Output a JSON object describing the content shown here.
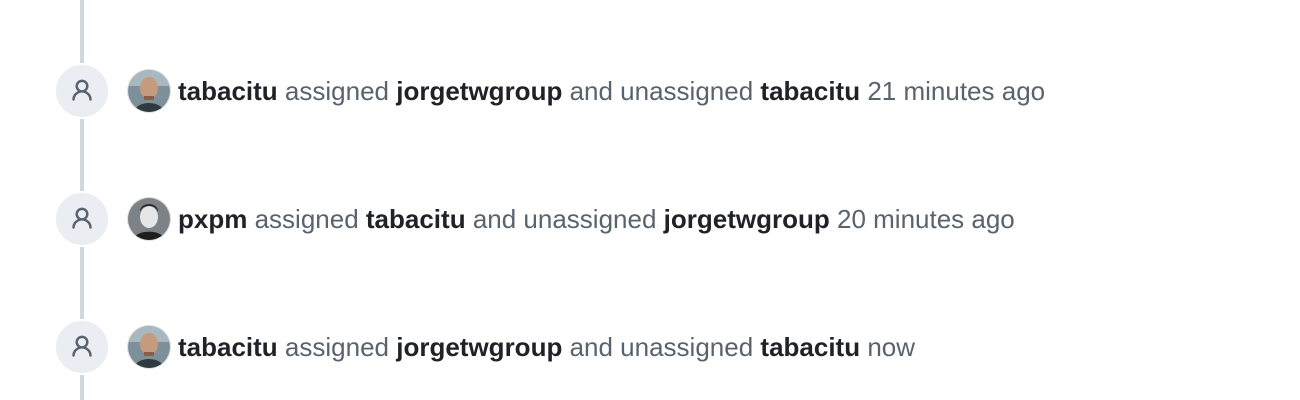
{
  "timeline": {
    "events": [
      {
        "actor": "tabacitu",
        "verb_assigned": "assigned",
        "assignee": "jorgetwgroup",
        "conjunction": "and unassigned",
        "unassignee": "tabacitu",
        "time": "21 minutes ago",
        "badge_icon": "person-icon",
        "avatar": "tabacitu-avatar"
      },
      {
        "actor": "pxpm",
        "verb_assigned": "assigned",
        "assignee": "tabacitu",
        "conjunction": "and unassigned",
        "unassignee": "jorgetwgroup",
        "time": "20 minutes ago",
        "badge_icon": "person-icon",
        "avatar": "pxpm-avatar"
      },
      {
        "actor": "tabacitu",
        "verb_assigned": "assigned",
        "assignee": "jorgetwgroup",
        "conjunction": "and unassigned",
        "unassignee": "tabacitu",
        "time": "now",
        "badge_icon": "person-icon",
        "avatar": "tabacitu-avatar"
      }
    ]
  },
  "colors": {
    "line": "#d0d7de",
    "badge_bg": "#eaeef2",
    "icon": "#59636e",
    "muted_text": "#59636e",
    "bold_text": "#1f2328"
  }
}
